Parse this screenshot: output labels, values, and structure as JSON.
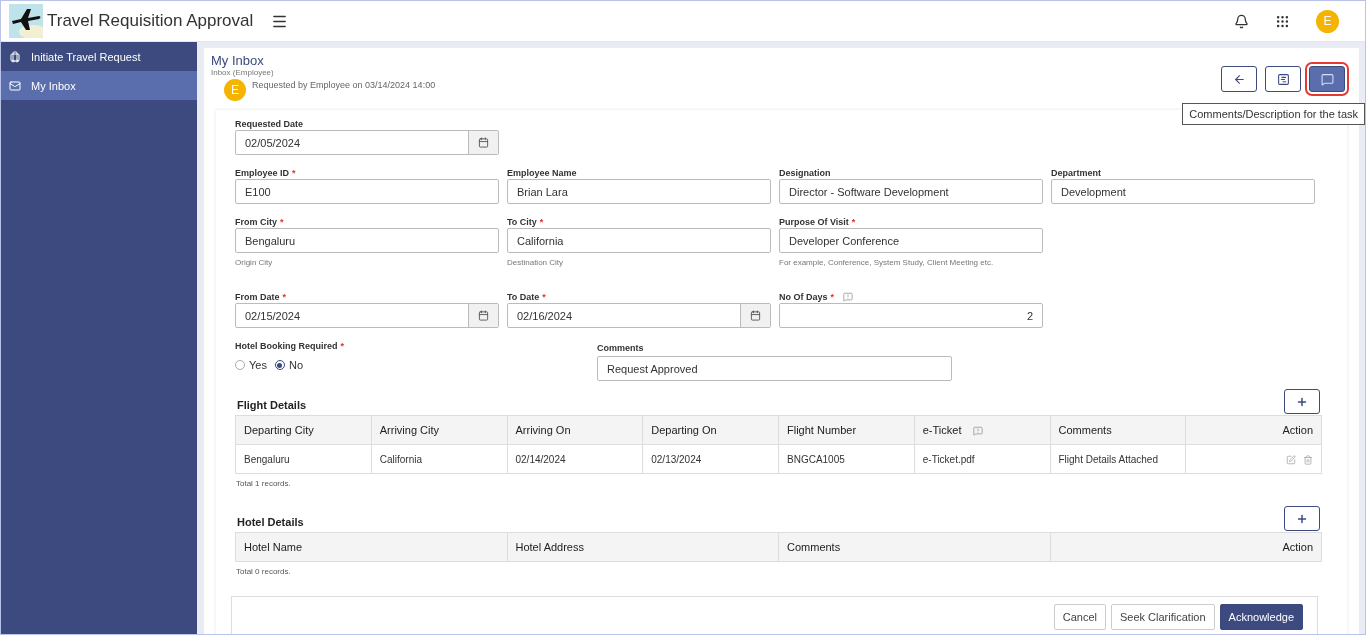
{
  "header": {
    "title": "Travel Requisition Approval",
    "avatar": "E"
  },
  "sidebar": {
    "items": [
      {
        "label": "Initiate Travel Request",
        "kind": "request",
        "selected": false
      },
      {
        "label": "My Inbox",
        "kind": "inbox",
        "selected": true
      }
    ]
  },
  "page": {
    "title": "My Inbox",
    "subtitle": "Inbox (Employee)",
    "avatar": "E",
    "requested_by": "Requested by Employee on 03/14/2024 14:00"
  },
  "toolbar": [
    {
      "kind": "back",
      "selected": false
    },
    {
      "kind": "form",
      "selected": false
    },
    {
      "kind": "comments",
      "selected": true
    }
  ],
  "tooltip": "Comments/Description for the task",
  "form": {
    "rows": [
      [
        {
          "label": "Requested Date",
          "kind": "date",
          "value": "02/05/2024"
        }
      ],
      [
        {
          "label": "Employee ID",
          "required_mark": "*",
          "kind": "text",
          "value": "E100"
        },
        {
          "label": "Employee Name",
          "kind": "text",
          "value": "Brian Lara"
        },
        {
          "label": "Designation",
          "kind": "text",
          "value": "Director - Software Development"
        },
        {
          "label": "Department",
          "kind": "text",
          "value": "Development"
        }
      ],
      [
        {
          "label": "From City",
          "required_mark": "*",
          "kind": "text",
          "value": "Bengaluru",
          "hint": "Origin City"
        },
        {
          "label": "To City",
          "required_mark": "*",
          "kind": "text",
          "value": "California",
          "hint": "Destination City"
        },
        {
          "label": "Purpose Of Visit",
          "required_mark": "*",
          "kind": "text",
          "value": "Developer Conference",
          "hint": "For example, Conference, System Study, Client Meeting etc."
        }
      ],
      [
        {
          "label": "From Date",
          "required_mark": "*",
          "kind": "date",
          "value": "02/15/2024"
        },
        {
          "label": "To Date",
          "required_mark": "*",
          "kind": "date",
          "value": "02/16/2024"
        },
        {
          "label": "No Of Days",
          "required_mark": "*",
          "kind": "number",
          "value": "2",
          "help": true
        }
      ]
    ],
    "hotel_booking": {
      "label": "Hotel Booking Required",
      "required_mark": "*",
      "options": [
        {
          "label": "Yes",
          "selected": false
        },
        {
          "label": "No",
          "selected": true
        }
      ]
    },
    "comments": {
      "label": "Comments",
      "value": "Request Approved"
    }
  },
  "flight_details": {
    "title": "Flight Details",
    "columns": [
      {
        "label": "Departing City"
      },
      {
        "label": "Arriving City"
      },
      {
        "label": "Arriving On"
      },
      {
        "label": "Departing On"
      },
      {
        "label": "Flight Number"
      },
      {
        "label": "e-Ticket",
        "help": true
      },
      {
        "label": "Comments"
      },
      {
        "label": "Action"
      }
    ],
    "rows": [
      [
        "Bengaluru",
        "California",
        "02/14/2024",
        "02/13/2024",
        "BNGCA1005",
        "e-Ticket.pdf",
        "Flight Details Attached"
      ]
    ],
    "total": "Total 1 records."
  },
  "hotel_details": {
    "title": "Hotel Details",
    "columns": [
      {
        "label": "Hotel Name"
      },
      {
        "label": "Hotel Address"
      },
      {
        "label": "Comments"
      },
      {
        "label": "Action"
      }
    ],
    "total": "Total 0 records."
  },
  "buttons": [
    {
      "label": "Cancel",
      "kind": "secondary"
    },
    {
      "label": "Seek Clarification",
      "kind": "secondary"
    },
    {
      "label": "Acknowledge",
      "kind": "primary"
    }
  ]
}
